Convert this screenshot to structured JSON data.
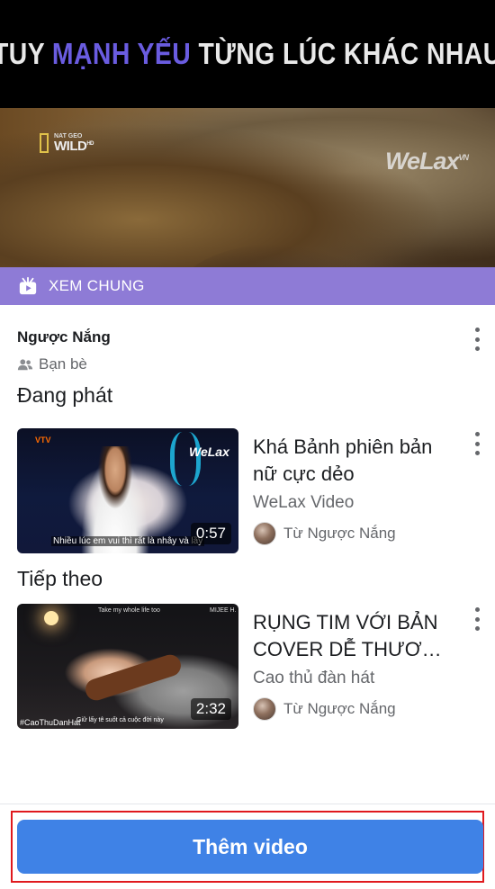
{
  "player": {
    "caption_parts": [
      "TUY ",
      "MẠNH YẾU",
      " TỪNG LÚC KHÁC NHAU"
    ],
    "logo_small": "NAT GEO",
    "logo_big": "WILD",
    "logo_suffix": "HD",
    "watermark": "WeLax",
    "watermark_suffix": "VN",
    "accent_color": "#6a5ce0"
  },
  "watch_bar": {
    "label": "XEM CHUNG",
    "icon": "watch-party-icon",
    "color": "#8e7bd6"
  },
  "host": {
    "name": "Ngược Nắng",
    "audience": "Bạn bè",
    "audience_icon": "friends-icon"
  },
  "sections": {
    "now_playing": "Đang phát",
    "up_next": "Tiếp theo"
  },
  "videos": [
    {
      "title": "Khá Bảnh phiên bản nữ cực dẻo",
      "title_line1": "Khá Bảnh phiên bản",
      "title_line2": "nữ cực dẻo",
      "channel": "WeLax Video",
      "from": "Từ Ngược Nắng",
      "duration": "0:57",
      "thumb_logo": "VTV",
      "thumb_watermark": "WeLax",
      "thumb_subtitle": "Nhiều lúc em vui thì rất là nhây và lầy"
    },
    {
      "title": "RỤNG TIM VỚI BẢN COVER DỄ THƯƠNG...",
      "title_line1": "RỤNG TIM VỚI BẢN",
      "title_line2": "COVER DỄ THƯƠNG...",
      "channel": "Cao thủ đàn hát",
      "from": "Từ Ngược Nắng",
      "duration": "2:32",
      "thumb_top": "Take my whole life too",
      "thumb_brand": "MIJEE H.",
      "thumb_tag": "#CaoThuDanHat",
      "thumb_subtitle": "Giữ lấy tê suốt cả cuộc đời này"
    }
  ],
  "footer": {
    "add_video_label": "Thêm video",
    "button_color": "#3f82e6",
    "highlight_color": "#e0191e"
  }
}
